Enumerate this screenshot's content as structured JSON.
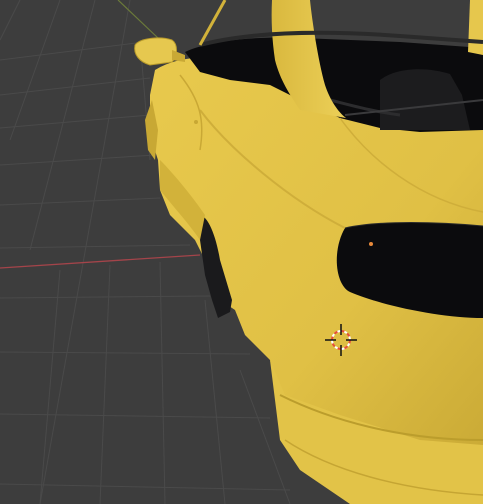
{
  "viewport": {
    "background_color": "#3d3d3d",
    "grid_color": "#4b4b4b",
    "x_axis_color": "#a4444a",
    "model_color": "#e4c445",
    "model_shadow_color": "#b99b2a",
    "cavity_color": "#0b0b0d"
  },
  "cursor": {
    "icon": "3d-cursor-icon",
    "ring_colors": [
      "#e64b3c",
      "#ffffff"
    ]
  }
}
